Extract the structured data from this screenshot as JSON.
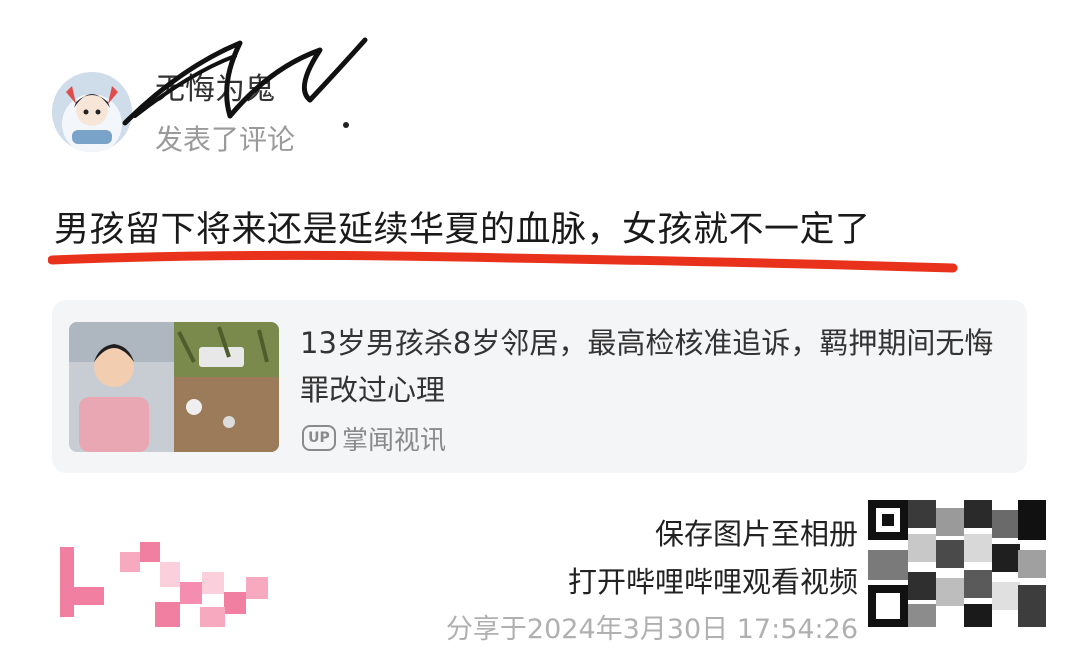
{
  "post": {
    "username": "无悔为鬼",
    "action": "发表了评论",
    "comment": "男孩留下将来还是延续华夏的血脉，女孩就不一定了"
  },
  "link_card": {
    "title": "13岁男孩杀8岁邻居，最高检核准追诉，羁押期间无悔罪改过心理",
    "source_badge": "UP",
    "source": "掌闻视讯"
  },
  "share": {
    "save_label": "保存图片至相册",
    "open_label": "打开哔哩哔哩观看视频",
    "shared_at": "分享于2024年3月30日 17:54:26"
  },
  "colors": {
    "underline": "#e8321c",
    "card_bg": "#f4f5f7",
    "muted_text": "#9a9a9a"
  }
}
